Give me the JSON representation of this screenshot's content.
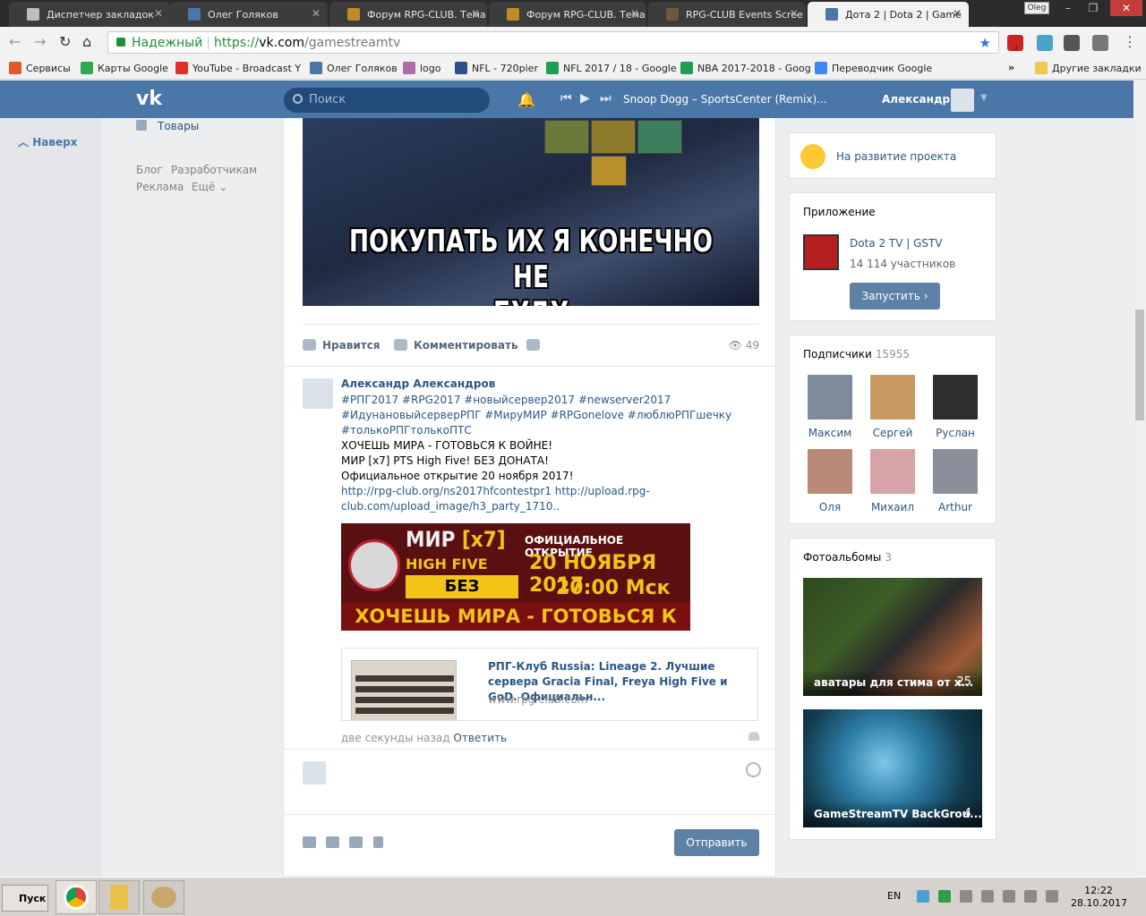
{
  "browser": {
    "tabs": [
      {
        "title": "Диспетчер закладок",
        "icon": "star-icon",
        "active": false
      },
      {
        "title": "Олег Голяков",
        "icon": "play-icon",
        "active": false
      },
      {
        "title": "Форум RPG-CLUB. Тема",
        "icon": "crest-icon",
        "active": false
      },
      {
        "title": "Форум RPG-CLUB. Тема",
        "icon": "crest-icon",
        "active": false
      },
      {
        "title": "RPG-CLUB Events Scree",
        "icon": "game-icon",
        "active": false
      },
      {
        "title": "Дота 2 | Dota 2 | Game",
        "icon": "vk-icon",
        "active": true
      }
    ],
    "profile_badge": "Oleg",
    "secure_label": "Надежный",
    "url": {
      "proto": "https://",
      "host": "vk.com",
      "path": "/gamestreamtv"
    },
    "extension_badge": "4",
    "bookmarks": [
      "Сервисы",
      "Карты Google",
      "YouTube - Broadcast Y",
      "Олег Голяков",
      "logo",
      "NFL - 720pier",
      "NFL 2017 / 18 - Google",
      "NBA 2017-2018 - Goog",
      "Переводчик Google"
    ],
    "bookmarks_more": "»",
    "other_bookmarks": "Другие закладки"
  },
  "vk": {
    "logo": "vk",
    "search_placeholder": "Поиск",
    "now_playing": "Snoop Dogg – SportsCenter (Remix)...",
    "user_name": "Александр"
  },
  "left": {
    "to_top": "Наверх",
    "goods": "Товары",
    "footer": [
      "Блог",
      "Разработчикам",
      "Реклама",
      "Ещё"
    ]
  },
  "post": {
    "meme_caption_line1": "ПОКУПАТЬ ИХ Я КОНЕЧНО НЕ",
    "meme_caption_line2": "БУДУ",
    "like_label": "Нравится",
    "comment_label": "Комментировать",
    "views": "49"
  },
  "comment": {
    "author": "Александр Александров",
    "tags_line1": "#РПГ2017 #RPG2017 #новыйсервер2017 #newserver2017",
    "tags_line2": "#ИдунановыйсерверРПГ #МируМИР #RPGonelove #люблюРПГшечку",
    "tags_line3": "#толькоРПГтолькоПТС",
    "text_line1": "ХОЧЕШЬ МИРА - ГОТОВЬСЯ К ВОЙНЕ!",
    "text_line2": "МИР [x7] PTS High Five! БЕЗ ДОНАТА!",
    "text_line3": "Официальное открытие 20 ноября 2017!",
    "links_line1": "http://rpg-club.org/ns2017hfcontestpr1 http://upload.rpg-",
    "links_line2": "club.com/upload_image/h3_party_1710..",
    "banner": {
      "title": "МИР",
      "rate": "[x7]",
      "subtitle": "HIGH FIVE",
      "no_donate": "БЕЗ ДОНАТА",
      "opening": "ОФИЦИАЛЬНОЕ ОТКРЫТИЕ",
      "date": "20 НОЯБРЯ 2017",
      "time": "20:00 Мск",
      "slogan": "ХОЧЕШЬ МИРА - ГОТОВЬСЯ К ВОЙНЕ"
    },
    "link_title": "РПГ-Клуб Russia: Lineage 2. Лучшие сервера Gracia Final, Freya High Five и GoD. Официальн...",
    "link_host": "www.rpg-club.com",
    "time": "две секунды назад",
    "reply": "Ответить"
  },
  "composer": {
    "send_label": "Отправить"
  },
  "right": {
    "donate": "На развитие проекта",
    "app_title": "Приложение",
    "app_name": "Dota 2 TV | GSTV",
    "app_members": "14 114 участников",
    "launch_label": "Запустить ›",
    "subscribers_title": "Подписчики",
    "subscribers_count": "15955",
    "subscribers": [
      {
        "name": "Максим",
        "color": "#7d8b9c"
      },
      {
        "name": "Сергей",
        "color": "#c89a62"
      },
      {
        "name": "Руслан",
        "color": "#2f2f2f"
      },
      {
        "name": "Оля",
        "color": "#b98a77"
      },
      {
        "name": "Михаил",
        "color": "#d7a3a6"
      },
      {
        "name": "Arthur",
        "color": "#8a8f9b"
      }
    ],
    "albums_title": "Фотоальбомы",
    "albums_count": "3",
    "albums": [
      {
        "caption": "аватары для стима от х...",
        "count": "25"
      },
      {
        "caption": "GameStreamTV BackGrou...",
        "count": "4"
      }
    ]
  },
  "taskbar": {
    "start_label": "Пуск",
    "lang": "EN",
    "time": "12:22",
    "date": "28.10.2017"
  },
  "colors": {
    "vk_header": "#4a76a8",
    "link": "#2a5885",
    "button": "#5e81a8",
    "secure_green": "#1e8f37"
  }
}
